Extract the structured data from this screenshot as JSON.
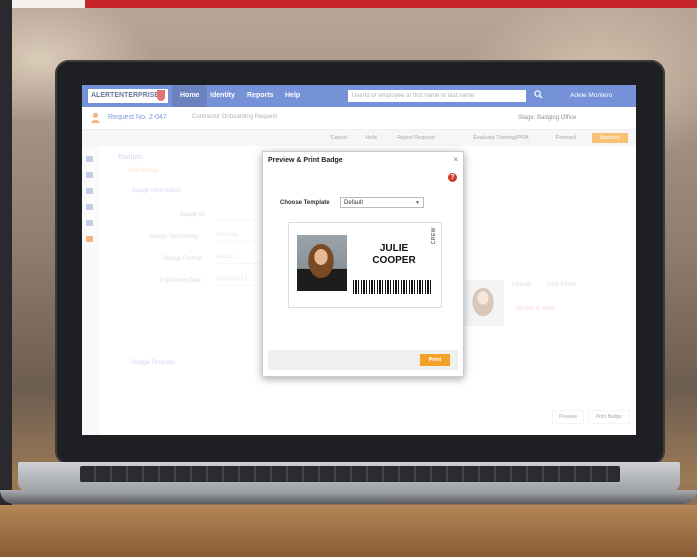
{
  "app": {
    "logo_text": "ALERTENTERPRISE",
    "nav": [
      "Home",
      "Identity",
      "Reports",
      "Help"
    ],
    "search_placeholder": "UserId or employee or first name or last name",
    "user_name": "Adele Montero"
  },
  "request": {
    "title": "Request No. 2-047",
    "subtitle": "Contractor Onboarding Request",
    "stage": "Stage: Badging Office",
    "actions": [
      "Cancel",
      "Hold",
      "Reject Request",
      "Evaluate Training/PRA",
      "Forward",
      "Approve"
    ]
  },
  "background_form": {
    "section": "Badges",
    "new_badge": "New Badge",
    "badge_info": "Badge Information",
    "labels": [
      "Badge ID",
      "Badge Technology",
      "Badge Format",
      "Expiration Date"
    ],
    "values": [
      "",
      "Proximity",
      "H10301",
      "10/14/2018 T"
    ],
    "badge_template": "Badge Template",
    "right_buttons": [
      "Upload",
      "Live Photo"
    ],
    "warning": "Shown & Valid",
    "bottom_buttons": [
      "Preview",
      "Print Badge"
    ]
  },
  "modal": {
    "title": "Preview & Print Badge",
    "close": "×",
    "help": "?",
    "template_label": "Choose Template",
    "template_value": "Default",
    "badge_first": "JULIE",
    "badge_last": "COOPER",
    "badge_vertical": "CREW",
    "print_label": "Print"
  },
  "colors": {
    "topbar": "#2c56c4",
    "accent_orange": "#f4a12a",
    "brand_red": "#c8242c"
  }
}
